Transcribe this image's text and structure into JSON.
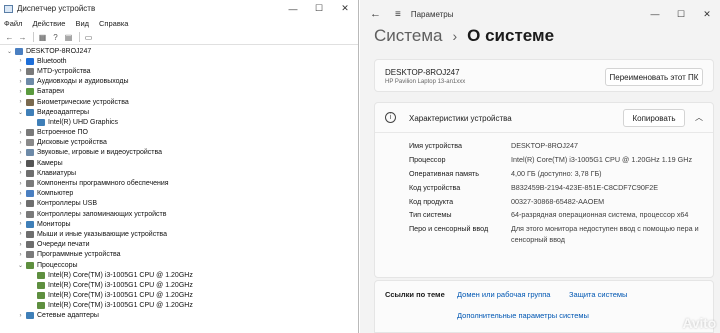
{
  "device_manager": {
    "title": "Диспетчер устройств",
    "menu": [
      "Файл",
      "Действие",
      "Вид",
      "Справка"
    ],
    "tree": [
      {
        "label": "DESKTOP-8ROJ247",
        "level": 0,
        "expander": "⌄",
        "icon": "computer-icon",
        "color": "#4a7fc1"
      },
      {
        "label": "Bluetooth",
        "level": 1,
        "expander": "›",
        "icon": "bluetooth-icon",
        "color": "#1e6fd9"
      },
      {
        "label": "MTD-устройства",
        "level": 1,
        "expander": "›",
        "icon": "device-icon",
        "color": "#7a7a7a"
      },
      {
        "label": "Аудиовходы и аудиовыходы",
        "level": 1,
        "expander": "›",
        "icon": "speaker-icon",
        "color": "#6d8aa8"
      },
      {
        "label": "Батареи",
        "level": 1,
        "expander": "›",
        "icon": "battery-icon",
        "color": "#5b9b3f"
      },
      {
        "label": "Биометрические устройства",
        "level": 1,
        "expander": "›",
        "icon": "fingerprint-icon",
        "color": "#7a6a4f"
      },
      {
        "label": "Видеоадаптеры",
        "level": 1,
        "expander": "⌄",
        "icon": "display-adapter-icon",
        "color": "#3f7fb8"
      },
      {
        "label": "Intel(R) UHD Graphics",
        "level": 2,
        "expander": "",
        "icon": "display-adapter-icon",
        "color": "#3f7fb8"
      },
      {
        "label": "Встроенное ПО",
        "level": 1,
        "expander": "›",
        "icon": "firmware-icon",
        "color": "#7a7a7a"
      },
      {
        "label": "Дисковые устройства",
        "level": 1,
        "expander": "›",
        "icon": "disk-icon",
        "color": "#8a8a8a"
      },
      {
        "label": "Звуковые, игровые и видеоустройства",
        "level": 1,
        "expander": "›",
        "icon": "sound-icon",
        "color": "#6d8aa8"
      },
      {
        "label": "Камеры",
        "level": 1,
        "expander": "›",
        "icon": "camera-icon",
        "color": "#555555"
      },
      {
        "label": "Клавиатуры",
        "level": 1,
        "expander": "›",
        "icon": "keyboard-icon",
        "color": "#6e6e6e"
      },
      {
        "label": "Компоненты программного обеспечения",
        "level": 1,
        "expander": "›",
        "icon": "software-component-icon",
        "color": "#7a7a7a"
      },
      {
        "label": "Компьютер",
        "level": 1,
        "expander": "›",
        "icon": "computer-icon",
        "color": "#4a7fc1"
      },
      {
        "label": "Контроллеры USB",
        "level": 1,
        "expander": "›",
        "icon": "usb-icon",
        "color": "#6e6e6e"
      },
      {
        "label": "Контроллеры запоминающих устройств",
        "level": 1,
        "expander": "›",
        "icon": "storage-controller-icon",
        "color": "#7a7a7a"
      },
      {
        "label": "Мониторы",
        "level": 1,
        "expander": "›",
        "icon": "monitor-icon",
        "color": "#3f7fb8"
      },
      {
        "label": "Мыши и иные указывающие устройства",
        "level": 1,
        "expander": "›",
        "icon": "mouse-icon",
        "color": "#6e6e6e"
      },
      {
        "label": "Очереди печати",
        "level": 1,
        "expander": "›",
        "icon": "printer-icon",
        "color": "#6e6e6e"
      },
      {
        "label": "Программные устройства",
        "level": 1,
        "expander": "›",
        "icon": "software-device-icon",
        "color": "#7a7a7a"
      },
      {
        "label": "Процессоры",
        "level": 1,
        "expander": "⌄",
        "icon": "processor-icon",
        "color": "#5e8f3f"
      },
      {
        "label": "Intel(R) Core(TM) i3-1005G1 CPU @ 1.20GHz",
        "level": 2,
        "expander": "",
        "icon": "processor-icon",
        "color": "#5e8f3f"
      },
      {
        "label": "Intel(R) Core(TM) i3-1005G1 CPU @ 1.20GHz",
        "level": 2,
        "expander": "",
        "icon": "processor-icon",
        "color": "#5e8f3f"
      },
      {
        "label": "Intel(R) Core(TM) i3-1005G1 CPU @ 1.20GHz",
        "level": 2,
        "expander": "",
        "icon": "processor-icon",
        "color": "#5e8f3f"
      },
      {
        "label": "Intel(R) Core(TM) i3-1005G1 CPU @ 1.20GHz",
        "level": 2,
        "expander": "",
        "icon": "processor-icon",
        "color": "#5e8f3f"
      },
      {
        "label": "Сетевые адаптеры",
        "level": 1,
        "expander": "›",
        "icon": "network-adapter-icon",
        "color": "#3f7fb8"
      }
    ]
  },
  "settings": {
    "title": "Параметры",
    "breadcrumb": {
      "parent": "Система",
      "separator": "›",
      "current": "О системе"
    },
    "device": {
      "name": "DESKTOP-8ROJ247",
      "model": "HP Pavilion Laptop 13-an1xxx",
      "rename_label": "Переименовать этот ПК"
    },
    "specs": {
      "title": "Характеристики устройства",
      "copy_label": "Копировать",
      "rows": [
        {
          "key": "Имя устройства",
          "value": "DESKTOP-8ROJ247"
        },
        {
          "key": "Процессор",
          "value": "Intel(R) Core(TM) i3-1005G1 CPU @ 1.20GHz   1.19 GHz"
        },
        {
          "key": "Оперативная память",
          "value": "4,00 ГБ (доступно: 3,78 ГБ)"
        },
        {
          "key": "Код устройства",
          "value": "B832459B-2194-423E-851E-C8CDF7C90F2E"
        },
        {
          "key": "Код продукта",
          "value": "00327-30868-65482-AAOEM"
        },
        {
          "key": "Тип системы",
          "value": "64-разрядная операционная система, процессор x64"
        },
        {
          "key": "Перо и сенсорный ввод",
          "value": "Для этого монитора недоступен ввод с помощью пера и сенсорный ввод"
        }
      ]
    },
    "related": {
      "label": "Ссылки по теме",
      "links": [
        "Домен или рабочая группа",
        "Защита системы",
        "Дополнительные параметры системы"
      ]
    }
  },
  "watermark": "Avito"
}
